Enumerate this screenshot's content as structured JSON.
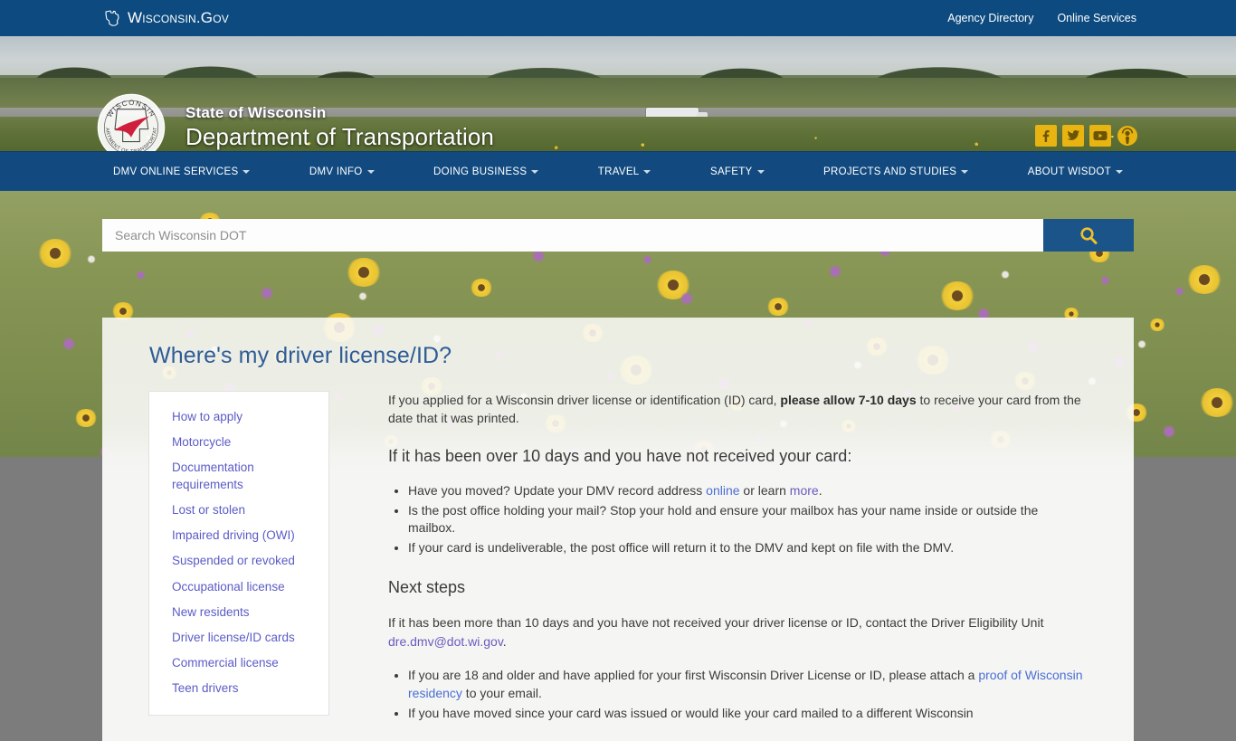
{
  "govbar": {
    "wordmark": "Wisconsin.Gov",
    "links": [
      {
        "label": "Agency Directory"
      },
      {
        "label": "Online Services"
      }
    ]
  },
  "banner": {
    "agency_line": "State of Wisconsin",
    "agency_name": "Department of Transportation",
    "seal_top_text": "WISCONSIN",
    "seal_bottom_text": "DEPARTMENT OF TRANSPORTATION",
    "social": [
      {
        "name": "facebook-icon",
        "glyph": "f"
      },
      {
        "name": "twitter-icon",
        "glyph": "ᵕ"
      },
      {
        "name": "youtube-icon",
        "glyph": "You"
      },
      {
        "name": "podcast-icon",
        "glyph": "◉"
      }
    ]
  },
  "nav": {
    "items": [
      {
        "label": "DMV ONLINE SERVICES",
        "has_dropdown": true
      },
      {
        "label": "DMV INFO",
        "has_dropdown": true
      },
      {
        "label": "DOING BUSINESS",
        "has_dropdown": true
      },
      {
        "label": "TRAVEL",
        "has_dropdown": true
      },
      {
        "label": "SAFETY",
        "has_dropdown": true
      },
      {
        "label": "PROJECTS AND STUDIES",
        "has_dropdown": true
      },
      {
        "label": "ABOUT WISDOT",
        "has_dropdown": true
      }
    ]
  },
  "search": {
    "placeholder": "Search Wisconsin DOT",
    "value": "",
    "button_icon": "search-icon"
  },
  "page": {
    "title": "Where's my driver license/ID?"
  },
  "sidebar": {
    "items": [
      {
        "label": "How to apply"
      },
      {
        "label": "Motorcycle"
      },
      {
        "label": "Documentation requirements"
      },
      {
        "label": "Lost or stolen"
      },
      {
        "label": "Impaired driving (OWI)"
      },
      {
        "label": "Suspended or revoked"
      },
      {
        "label": "Occupational license"
      },
      {
        "label": "New residents"
      },
      {
        "label": "Driver license/ID cards"
      },
      {
        "label": "Commercial license"
      },
      {
        "label": "Teen drivers"
      }
    ]
  },
  "content": {
    "intro_part1": "If you applied for a Wisconsin driver license or identification (ID) card, ",
    "intro_bold": "please allow 7-10 days",
    "intro_part2": " to receive your card from the date that it was printed.",
    "heading_over10": "If it has been over 10 days and you have not received your card:",
    "bullet1_part1": "Have you moved? Update your DMV record address ",
    "bullet1_link_online": "online",
    "bullet1_part2": " or learn ",
    "bullet1_link_more": "more",
    "bullet1_part3": ".",
    "bullet2": "Is the post office holding your mail? Stop your hold and ensure your mailbox has your name inside or outside the mailbox.",
    "bullet3": "If your card is undeliverable, the post office will return it to the DMV and kept on file with the DMV.",
    "heading_next_steps": "Next steps",
    "next_part1": "If it has been more than 10 days and you have not received your driver license or ID, contact the Driver Eligibility Unit ",
    "next_email": "dre.dmv@dot.wi.gov",
    "next_part2": ".",
    "bullet4_part1": "If you are 18 and older and have applied for your first Wisconsin Driver License or ID, please attach a ",
    "bullet4_link": "proof of Wisconsin residency",
    "bullet4_part2": " to your email.",
    "bullet5": "If you have moved since your card was issued or would like your card mailed to a different Wisconsin"
  },
  "colors": {
    "gov_bar": "#0c4a7f",
    "nav_bar": "#124a80",
    "title_blue": "#2f5c96",
    "link_blue": "#4a6fd4",
    "link_visited": "#5b5bc8",
    "social_gold": "#e7b412",
    "search_button": "#1b5489"
  }
}
